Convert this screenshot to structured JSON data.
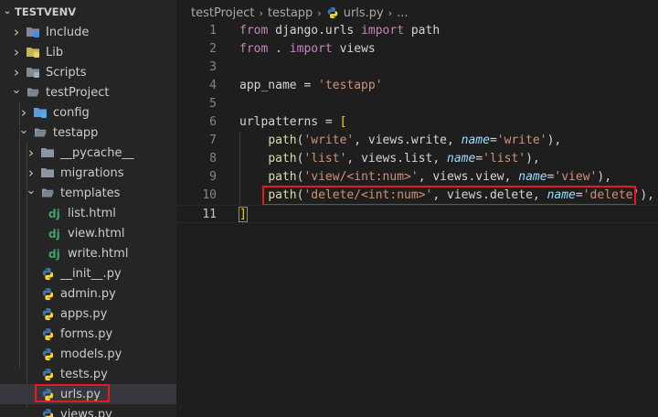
{
  "sidebar": {
    "title": "TESTVENV",
    "items": [
      {
        "label": "Include",
        "depth": 1,
        "arrow": "right",
        "icon": "folder-include-icon"
      },
      {
        "label": "Lib",
        "depth": 1,
        "arrow": "right",
        "icon": "folder-lib-icon"
      },
      {
        "label": "Scripts",
        "depth": 1,
        "arrow": "right",
        "icon": "folder-scripts-icon"
      },
      {
        "label": "testProject",
        "depth": 1,
        "arrow": "down",
        "icon": "folder-open-icon"
      },
      {
        "label": "config",
        "depth": 2,
        "arrow": "right",
        "icon": "folder-config-icon"
      },
      {
        "label": "testapp",
        "depth": 2,
        "arrow": "down",
        "icon": "folder-open-icon"
      },
      {
        "label": "__pycache__",
        "depth": 3,
        "arrow": "right",
        "icon": "folder-icon"
      },
      {
        "label": "migrations",
        "depth": 3,
        "arrow": "right",
        "icon": "folder-icon"
      },
      {
        "label": "templates",
        "depth": 3,
        "arrow": "down",
        "icon": "folder-open-icon"
      },
      {
        "label": "list.html",
        "depth": 4,
        "arrow": "",
        "icon": "django-icon"
      },
      {
        "label": "view.html",
        "depth": 4,
        "arrow": "",
        "icon": "django-icon"
      },
      {
        "label": "write.html",
        "depth": 4,
        "arrow": "",
        "icon": "django-icon"
      },
      {
        "label": "__init__.py",
        "depth": 3,
        "arrow": "",
        "icon": "python-icon"
      },
      {
        "label": "admin.py",
        "depth": 3,
        "arrow": "",
        "icon": "python-icon"
      },
      {
        "label": "apps.py",
        "depth": 3,
        "arrow": "",
        "icon": "python-icon"
      },
      {
        "label": "forms.py",
        "depth": 3,
        "arrow": "",
        "icon": "python-icon"
      },
      {
        "label": "models.py",
        "depth": 3,
        "arrow": "",
        "icon": "python-icon"
      },
      {
        "label": "tests.py",
        "depth": 3,
        "arrow": "",
        "icon": "python-icon"
      },
      {
        "label": "urls.py",
        "depth": 3,
        "arrow": "",
        "icon": "python-icon",
        "selected": true,
        "highlight": true
      },
      {
        "label": "views.py",
        "depth": 3,
        "arrow": "",
        "icon": "python-icon"
      }
    ]
  },
  "breadcrumb": {
    "items": [
      "testProject",
      "testapp",
      "urls.py",
      "..."
    ]
  },
  "editor": {
    "current_line": 11,
    "highlight_line": 10,
    "lines": [
      {
        "n": "1",
        "tokens": [
          [
            "kw",
            "from"
          ],
          [
            "pun",
            " django.urls "
          ],
          [
            "kw",
            "import"
          ],
          [
            "pun",
            " path"
          ]
        ]
      },
      {
        "n": "2",
        "tokens": [
          [
            "kw",
            "from"
          ],
          [
            "pun",
            " . "
          ],
          [
            "kw",
            "import"
          ],
          [
            "pun",
            " views"
          ]
        ]
      },
      {
        "n": "3",
        "tokens": []
      },
      {
        "n": "4",
        "tokens": [
          [
            "pun",
            "app_name = "
          ],
          [
            "str",
            "'testapp'"
          ]
        ]
      },
      {
        "n": "5",
        "tokens": []
      },
      {
        "n": "6",
        "tokens": [
          [
            "pun",
            "urlpatterns = "
          ],
          [
            "brk",
            "["
          ]
        ]
      },
      {
        "n": "7",
        "tokens": [
          [
            "pun",
            "    "
          ],
          [
            "fn",
            "path"
          ],
          [
            "pun",
            "("
          ],
          [
            "str",
            "'write'"
          ],
          [
            "pun",
            ", views.write, "
          ],
          [
            "par",
            "name"
          ],
          [
            "pun",
            "="
          ],
          [
            "str",
            "'write'"
          ],
          [
            "pun",
            "),"
          ]
        ]
      },
      {
        "n": "8",
        "tokens": [
          [
            "pun",
            "    "
          ],
          [
            "fn",
            "path"
          ],
          [
            "pun",
            "("
          ],
          [
            "str",
            "'list'"
          ],
          [
            "pun",
            ", views.list, "
          ],
          [
            "par",
            "name"
          ],
          [
            "pun",
            "="
          ],
          [
            "str",
            "'list'"
          ],
          [
            "pun",
            "),"
          ]
        ]
      },
      {
        "n": "9",
        "tokens": [
          [
            "pun",
            "    "
          ],
          [
            "fn",
            "path"
          ],
          [
            "pun",
            "("
          ],
          [
            "str",
            "'view/<int:num>'"
          ],
          [
            "pun",
            ", views.view, "
          ],
          [
            "par",
            "name"
          ],
          [
            "pun",
            "="
          ],
          [
            "str",
            "'view'"
          ],
          [
            "pun",
            "),"
          ]
        ]
      },
      {
        "n": "10",
        "tokens": [
          [
            "pun",
            "    "
          ],
          [
            "fn",
            "path"
          ],
          [
            "pun",
            "("
          ],
          [
            "str",
            "'delete/<int:num>'"
          ],
          [
            "pun",
            ", views.delete, "
          ],
          [
            "par",
            "name"
          ],
          [
            "pun",
            "="
          ],
          [
            "str",
            "'delete'"
          ],
          [
            "pun",
            "),"
          ]
        ]
      },
      {
        "n": "11",
        "tokens": [
          [
            "brk",
            "]"
          ]
        ]
      }
    ]
  },
  "colors": {
    "highlight_box": "#e51b23",
    "sidebar_bg": "#252526",
    "editor_bg": "#1e1e1e",
    "selected_row": "#37373d"
  }
}
